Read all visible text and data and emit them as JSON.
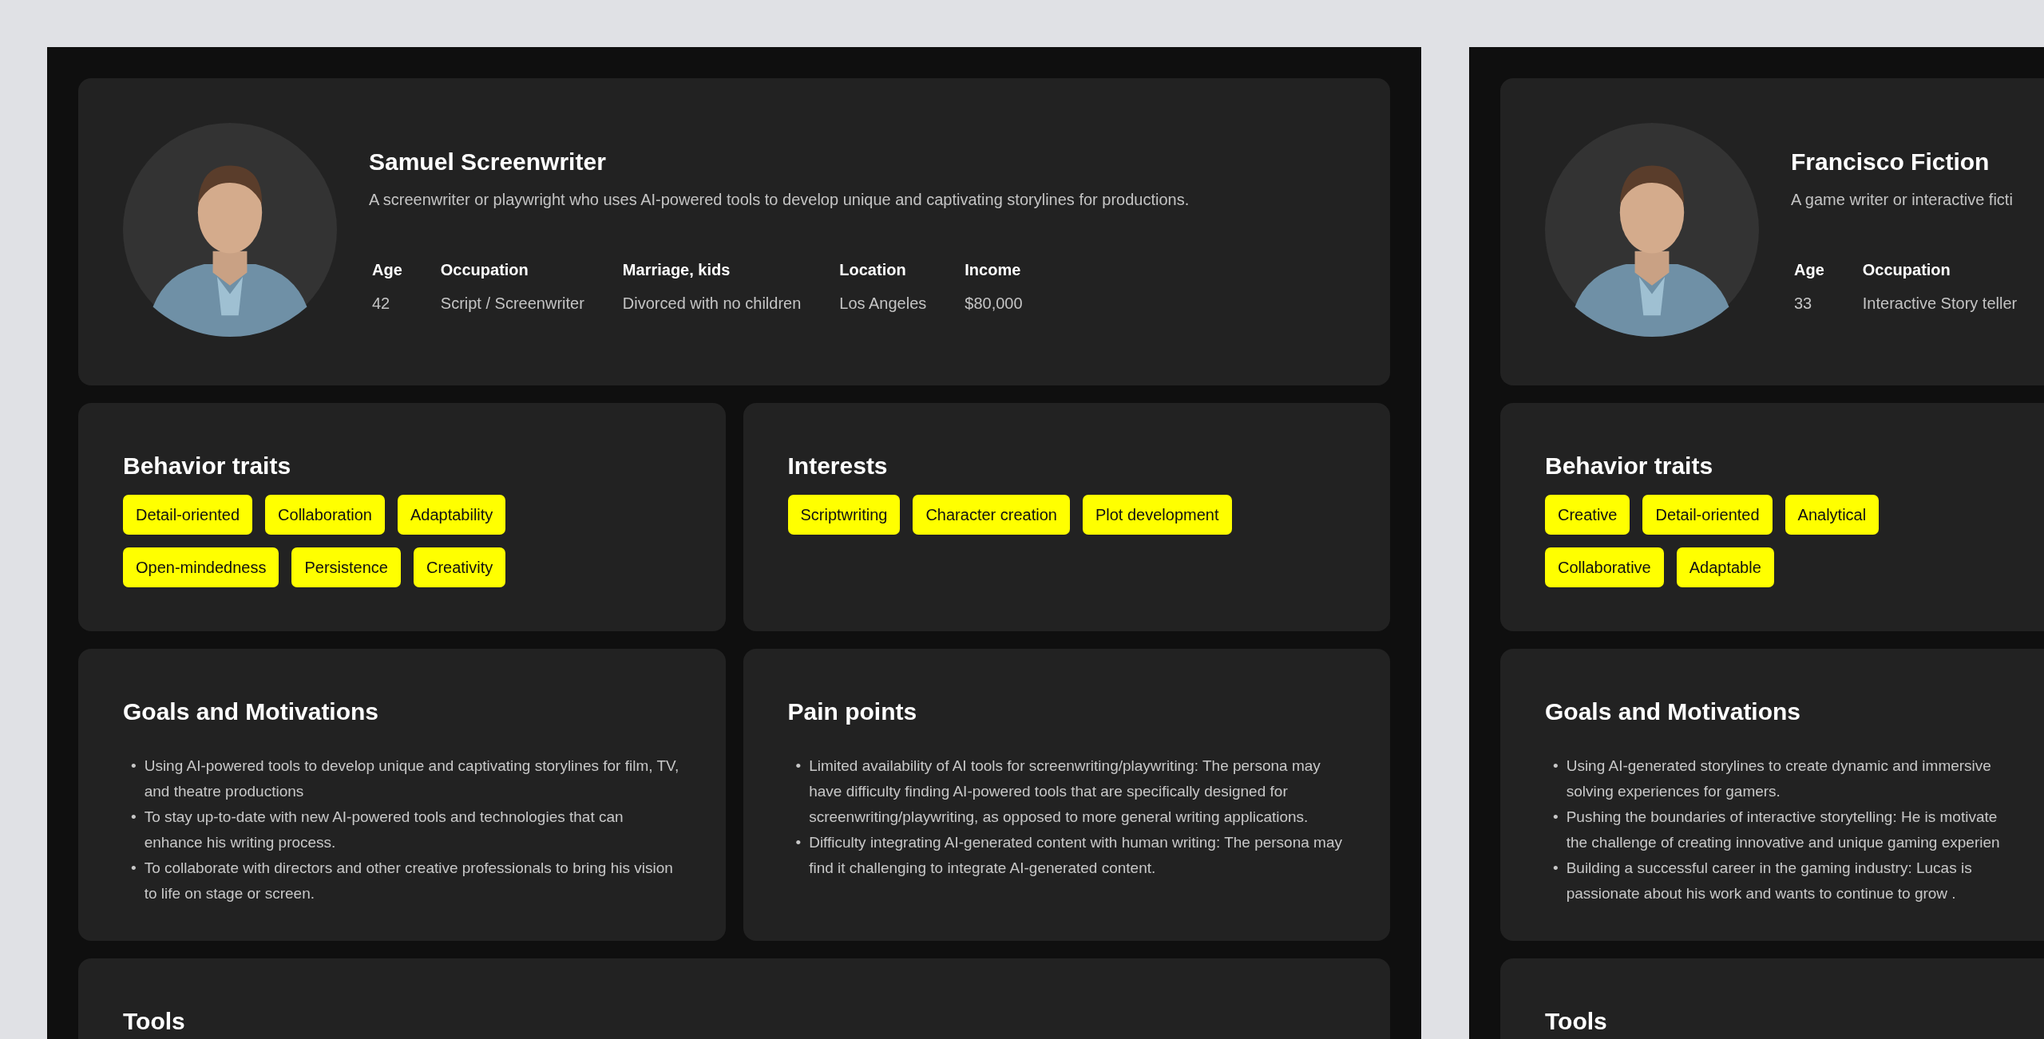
{
  "personas": [
    {
      "name": "Samuel Screenwriter",
      "description": "A screenwriter or playwright who uses AI-powered tools to develop unique and captivating storylines for productions.",
      "photo": {
        "kind": "picture"
      },
      "stats": [
        {
          "label": "Age",
          "value": "42"
        },
        {
          "label": "Occupation",
          "value": "Script / Screenwriter"
        },
        {
          "label": "Marriage, kids",
          "value": "Divorced with no children"
        },
        {
          "label": "Location",
          "value": "Los Angeles"
        },
        {
          "label": "Income",
          "value": "$80,000"
        }
      ],
      "rows": [
        [
          {
            "kind": "tags",
            "title": "Behavior traits",
            "tags": [
              "Detail-oriented",
              "Collaboration",
              "Adaptability",
              "Open-mindedness",
              "Persistence",
              "Creativity"
            ]
          },
          {
            "kind": "tags",
            "title": "Interests",
            "tags": [
              "Scriptwriting",
              "Character creation",
              "Plot development"
            ]
          }
        ],
        [
          {
            "kind": "list",
            "title": "Goals and Motivations",
            "items": [
              {
                "marker": "•",
                "lines": [
                  "Using AI-powered tools to develop unique and captivating storylines for film, TV, and theatre productions"
                ]
              },
              {
                "marker": "•",
                "lines": [
                  "To stay up-to-date with new AI-powered tools and technologies that can enhance his writing process."
                ]
              },
              {
                "marker": "•",
                "lines": [
                  "To collaborate with directors and other creative professionals to bring his vision to life on stage or screen."
                ]
              }
            ]
          },
          {
            "kind": "list",
            "title": "Pain points",
            "items": [
              {
                "marker": "•",
                "lines": [
                  "Limited availability of AI tools for screenwriting/playwriting: The persona may have difficulty finding AI-powered tools that are specifically designed for screenwriting/playwriting, as opposed to more general writing applications."
                ]
              },
              {
                "marker": "•",
                "lines": [
                  "Difficulty integrating AI-generated content with human writing: The persona may find it challenging to integrate AI-generated content."
                ]
              }
            ]
          }
        ],
        [
          {
            "kind": "heading",
            "title": "Tools"
          }
        ]
      ]
    },
    {
      "name": "Francisco Fiction",
      "description": "A game writer or interactive ficti",
      "photo": {
        "kind": "picture"
      },
      "stats": [
        {
          "label": "Age",
          "value": "33"
        },
        {
          "label": "Occupation",
          "value": "Interactive Story teller"
        }
      ],
      "rows": [
        [
          {
            "kind": "tags",
            "title": "Behavior traits",
            "tags": [
              "Creative",
              "Detail-oriented",
              "Analytical",
              "Collaborative",
              "Adaptable"
            ]
          }
        ],
        [
          {
            "kind": "list",
            "title": "Goals and Motivations",
            "items": [
              {
                "marker": "•",
                "lines": [
                  "Using AI-generated storylines to create dynamic and immersive",
                  "solving experiences for gamers."
                ]
              },
              {
                "marker": "•",
                "lines": [
                  "Pushing the boundaries of interactive storytelling: He is motivate",
                  "the challenge of creating innovative and unique gaming experien"
                ]
              },
              {
                "marker": "•",
                "lines": [
                  "Building a successful career in the gaming industry: Lucas is",
                  "passionate about his work and wants to continue to grow ."
                ]
              }
            ]
          }
        ],
        [
          {
            "kind": "heading",
            "title": "Tools"
          }
        ]
      ]
    }
  ]
}
